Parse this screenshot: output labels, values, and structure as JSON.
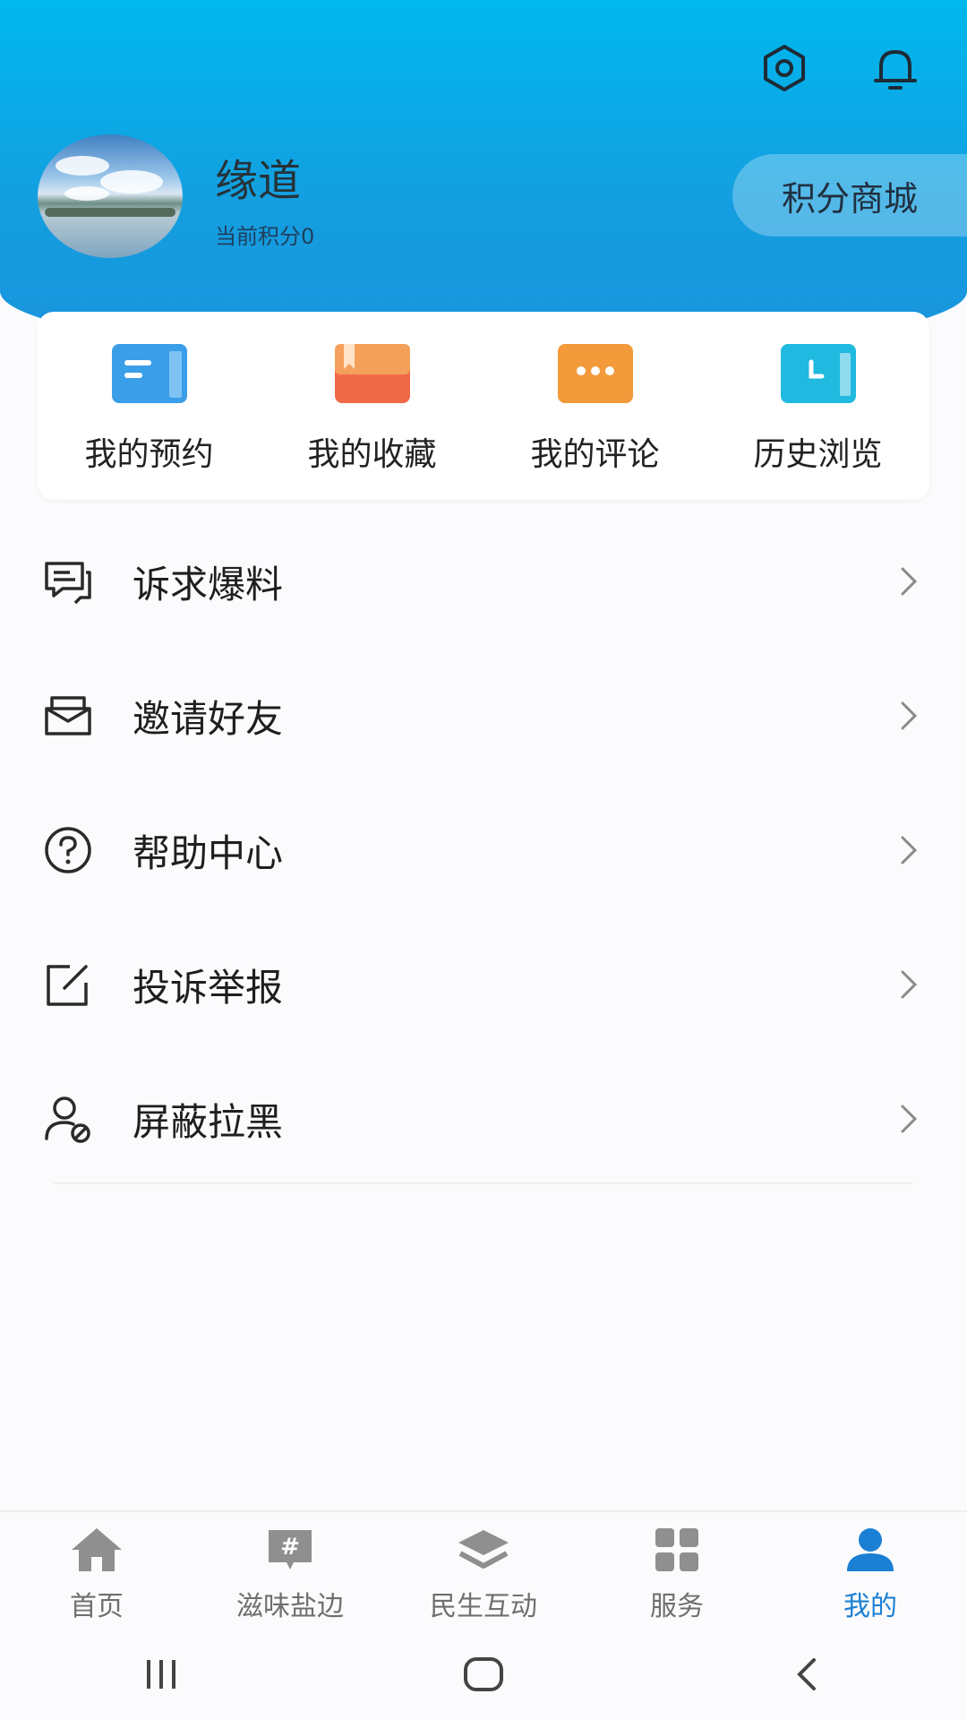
{
  "header": {
    "username": "缘道",
    "points_text": "当前积分0",
    "mall_label": "积分商城"
  },
  "quick_actions": [
    {
      "label": "我的预约",
      "icon": "calendar-card-icon",
      "color": "#3a9ee8"
    },
    {
      "label": "我的收藏",
      "icon": "bookmark-book-icon",
      "color": "#f06a4a"
    },
    {
      "label": "我的评论",
      "icon": "comment-bubble-icon",
      "color": "#f39a3a"
    },
    {
      "label": "历史浏览",
      "icon": "clock-card-icon",
      "color": "#20b9e0"
    }
  ],
  "menu": [
    {
      "label": "诉求爆料",
      "icon": "feedback-chat-icon"
    },
    {
      "label": "邀请好友",
      "icon": "invite-envelope-icon"
    },
    {
      "label": "帮助中心",
      "icon": "help-circle-icon"
    },
    {
      "label": "投诉举报",
      "icon": "edit-report-icon"
    },
    {
      "label": "屏蔽拉黑",
      "icon": "block-user-icon"
    }
  ],
  "bottom_nav": [
    {
      "label": "首页",
      "icon": "home-icon",
      "active": false
    },
    {
      "label": "滋味盐边",
      "icon": "hashtag-icon",
      "active": false
    },
    {
      "label": "民生互动",
      "icon": "layers-icon",
      "active": false
    },
    {
      "label": "服务",
      "icon": "grid-icon",
      "active": false
    },
    {
      "label": "我的",
      "icon": "user-icon",
      "active": true
    }
  ],
  "colors": {
    "header_top": "#00b8ee",
    "header_bottom": "#1b93dc",
    "active_tab": "#1b7fd4"
  }
}
